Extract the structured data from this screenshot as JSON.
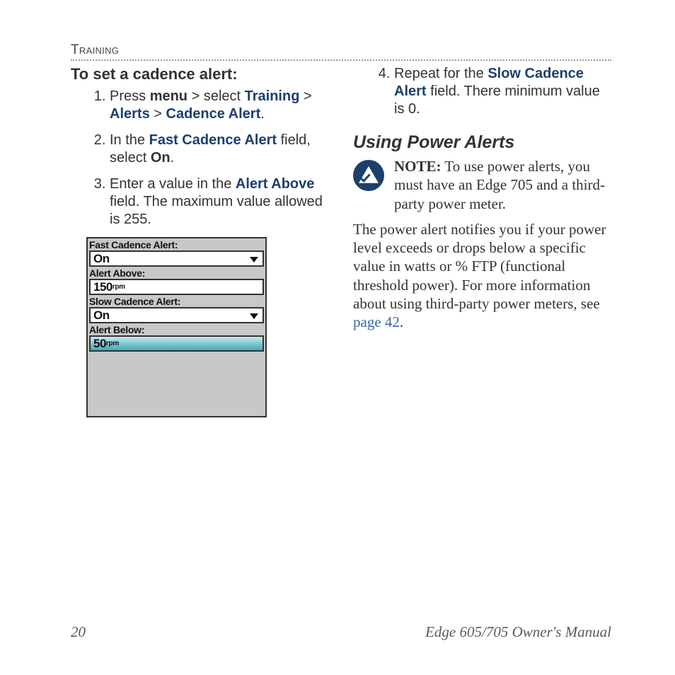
{
  "running_head": "Training",
  "task": {
    "title": "To set a cadence alert:",
    "steps_left": [
      {
        "pre": "Press ",
        "b1": "menu",
        "mid1": " > select ",
        "b2": "Training",
        "mid2": " > ",
        "b3": "Alerts",
        "mid3": " > ",
        "b4": "Cadence Alert",
        "post": "."
      },
      {
        "pre": "In the ",
        "b1": "Fast Cadence Alert",
        "mid1": " field, select ",
        "b2": "On",
        "post": "."
      },
      {
        "pre": "Enter a value in the ",
        "b1": "Alert Above",
        "mid1": " field. The maximum value allowed is 255.",
        "b2": "",
        "post": ""
      }
    ],
    "steps_right_start": 4,
    "steps_right": [
      {
        "pre": "Repeat for the ",
        "b1": "Slow Cadence Alert",
        "mid1": " field. There minimum value is 0.",
        "b2": "",
        "post": ""
      }
    ]
  },
  "device": {
    "fast_label": "Fast Cadence Alert:",
    "fast_value": "On",
    "above_label": "Alert Above:",
    "above_value": "150",
    "above_unit": "rpm",
    "slow_label": "Slow Cadence Alert:",
    "slow_value": "On",
    "below_label": "Alert Below:",
    "below_value": "50",
    "below_unit": "rpm"
  },
  "power": {
    "heading": "Using Power Alerts",
    "note_label": "NOTE:",
    "note_body": " To use power alerts, you must have an Edge 705 and a third-party power meter.",
    "body_pre": "The power alert notifies you if your power level exceeds or drops below a specific value in watts or % FTP (functional threshold power). For more information about using third-party power meters, see ",
    "link": "page 42",
    "body_post": "."
  },
  "footer": {
    "page": "20",
    "title": "Edge 605/705 Owner's Manual"
  }
}
